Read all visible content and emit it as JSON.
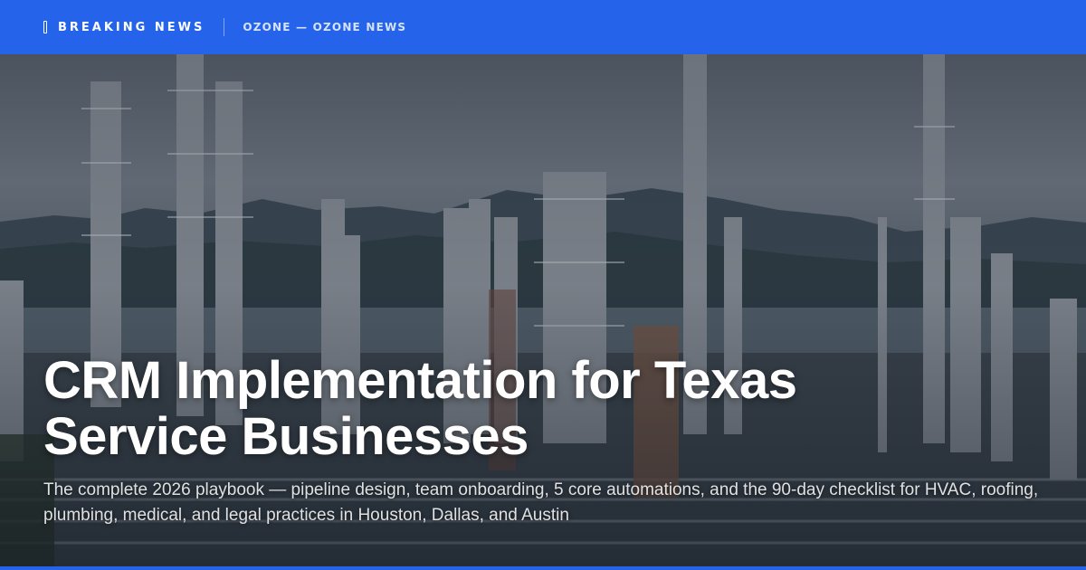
{
  "header": {
    "breaking_label": "BREAKING NEWS",
    "publisher": "OZONE — OZONE NEWS"
  },
  "article": {
    "title": "CRM Implementation for Texas Service Businesses",
    "subtitle": "The complete 2026 playbook — pipeline design, team onboarding, 5 core automations, and the 90-day checklist for HVAC, roofing, plumbing, medical, and legal practices in Houston, Dallas, and Austin"
  },
  "colors": {
    "accent": "#2563eb",
    "text": "#ffffff"
  },
  "icons": {
    "breaking": "bar-icon"
  }
}
